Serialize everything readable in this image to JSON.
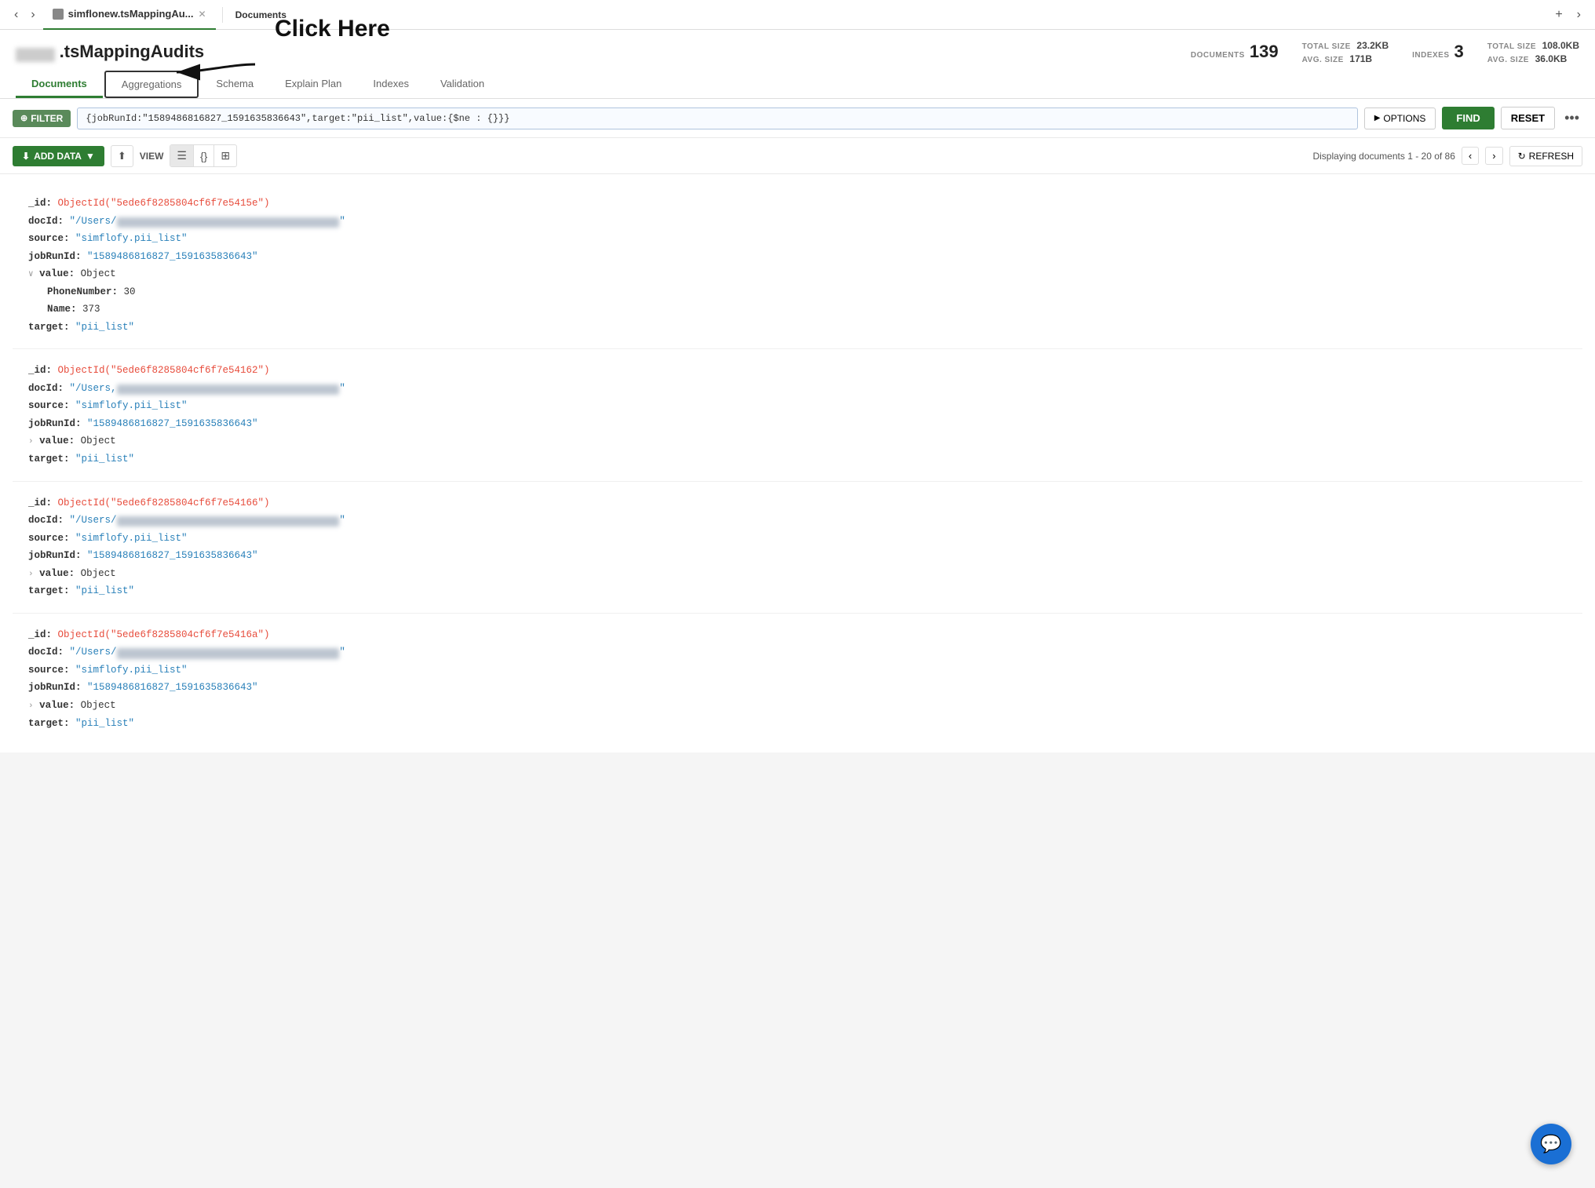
{
  "tabs": [
    {
      "id": "main",
      "label": "simflonew.tsMappingAu...",
      "active": true
    },
    {
      "id": "new",
      "label": "+",
      "isAdd": true
    }
  ],
  "tab_active_sublabel": "Documents",
  "header": {
    "prefix_placeholder": "",
    "collection_name": ".tsMappingAudits",
    "stats": {
      "documents_label": "DOCUMENTS",
      "documents_value": "139",
      "total_size_label1": "TOTAL SIZE",
      "total_size_val1": "23.2KB",
      "avg_size_label1": "AVG. SIZE",
      "avg_size_val1": "171B",
      "indexes_label": "INDEXES",
      "indexes_value": "3",
      "total_size_label2": "TOTAL SIZE",
      "total_size_val2": "108.0KB",
      "avg_size_label2": "AVG. SIZE",
      "avg_size_val2": "36.0KB"
    }
  },
  "annotation": {
    "click_here": "Click Here",
    "explain_plan": "Explain Plan"
  },
  "nav_tabs": [
    {
      "id": "documents",
      "label": "Documents",
      "active": true
    },
    {
      "id": "aggregations",
      "label": "Aggregations",
      "highlighted": true
    },
    {
      "id": "schema",
      "label": "Schema"
    },
    {
      "id": "explain_plan",
      "label": "Explain Plan"
    },
    {
      "id": "indexes",
      "label": "Indexes"
    },
    {
      "id": "validation",
      "label": "Validation"
    }
  ],
  "filter": {
    "badge": "FILTER",
    "query": "{jobRunId:\"1589486816827_1591635836643\",target:\"pii_list\",value:{$ne : {}}}",
    "options_label": "OPTIONS",
    "find_label": "FIND",
    "reset_label": "RESET"
  },
  "toolbar": {
    "add_data_label": "ADD DATA",
    "view_label": "VIEW",
    "pagination": "Displaying documents 1 - 20 of 86",
    "refresh_label": "REFRESH"
  },
  "documents": [
    {
      "id": "1",
      "objectid": "ObjectId(\"5ede6f8285804cf6f7e5415e\")",
      "docId_prefix": "/Users/",
      "docId_blurred": "redacted path string here for display",
      "source": "\"simflofy.pii_list\"",
      "jobRunId": "\"1589486816827_1591635836643\"",
      "has_value_expanded": true,
      "value_fields": [
        {
          "key": "PhoneNumber",
          "val": "30"
        },
        {
          "key": "Name",
          "val": "373"
        }
      ],
      "target": "\"pii_list\""
    },
    {
      "id": "2",
      "objectid": "ObjectId(\"5ede6f8285804cf6f7e54162\")",
      "docId_prefix": "/Users,",
      "docId_blurred": "redacted path blurred",
      "source": "\"simflofy.pii_list\"",
      "jobRunId": "\"1589486816827_1591635836643\"",
      "has_value_expanded": false,
      "value_fields": [],
      "target": "\"pii_list\""
    },
    {
      "id": "3",
      "objectid": "ObjectId(\"5ede6f8285804cf6f7e54166\")",
      "docId_prefix": "/Users/",
      "docId_blurred": "redacted path blurred longer",
      "source": "\"simflofy.pii_list\"",
      "jobRunId": "\"1589486816827_1591635836643\"",
      "has_value_expanded": false,
      "value_fields": [],
      "target": "\"pii_list\""
    },
    {
      "id": "4",
      "objectid": "ObjectId(\"5ede6f8285804cf6f7e5416a\")",
      "docId_prefix": "/Users/",
      "docId_blurred": "redacted path blurred medium",
      "source": "\"simflofy.pii_list\"",
      "jobRunId": "\"1589486816827_1591635836643\"",
      "has_value_expanded": false,
      "value_fields": [],
      "target": "\"pii_list\""
    }
  ]
}
